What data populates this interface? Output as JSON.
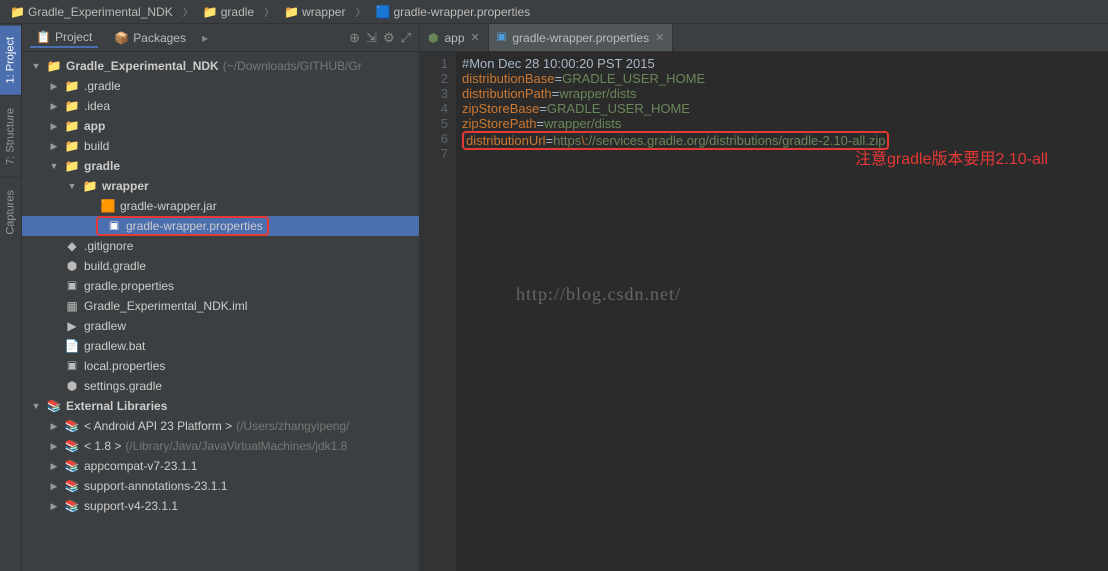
{
  "breadcrumb": [
    {
      "label": "Gradle_Experimental_NDK",
      "icon": "project"
    },
    {
      "label": "gradle",
      "icon": "folder"
    },
    {
      "label": "wrapper",
      "icon": "folder"
    },
    {
      "label": "gradle-wrapper.properties",
      "icon": "properties"
    }
  ],
  "sidebar_tabs": [
    {
      "label": "1: Project",
      "active": true
    },
    {
      "label": "7: Structure",
      "active": false
    },
    {
      "label": "Captures",
      "active": false
    }
  ],
  "panel": {
    "project_tab": "Project",
    "packages_tab": "Packages"
  },
  "tree": {
    "root": {
      "label": "Gradle_Experimental_NDK",
      "hint": "(~/Downloads/GITHUB/Gr"
    },
    "nodes": [
      {
        "label": ".gradle",
        "type": "folder",
        "indent": 1
      },
      {
        "label": ".idea",
        "type": "folder",
        "indent": 1
      },
      {
        "label": "app",
        "type": "folder",
        "bold": true,
        "indent": 1
      },
      {
        "label": "build",
        "type": "folder",
        "indent": 1
      },
      {
        "label": "gradle",
        "type": "folder",
        "bold": true,
        "indent": 1,
        "expanded": true
      },
      {
        "label": "wrapper",
        "type": "folder",
        "bold": true,
        "indent": 2,
        "expanded": true
      },
      {
        "label": "gradle-wrapper.jar",
        "type": "jar",
        "indent": 3
      },
      {
        "label": "gradle-wrapper.properties",
        "type": "properties",
        "indent": 3,
        "selected": true,
        "highlighted": true
      },
      {
        "label": ".gitignore",
        "type": "git",
        "indent": 1
      },
      {
        "label": "build.gradle",
        "type": "gradle",
        "indent": 1
      },
      {
        "label": "gradle.properties",
        "type": "properties",
        "indent": 1
      },
      {
        "label": "Gradle_Experimental_NDK.iml",
        "type": "iml",
        "indent": 1
      },
      {
        "label": "gradlew",
        "type": "sh",
        "indent": 1
      },
      {
        "label": "gradlew.bat",
        "type": "file",
        "indent": 1
      },
      {
        "label": "local.properties",
        "type": "properties",
        "indent": 1
      },
      {
        "label": "settings.gradle",
        "type": "gradle",
        "indent": 1
      }
    ],
    "external": {
      "label": "External Libraries",
      "items": [
        {
          "label": "< Android API 23 Platform >",
          "hint": "(/Users/zhangyipeng/"
        },
        {
          "label": "< 1.8 >",
          "hint": "(/Library/Java/JavaVirtualMachines/jdk1.8"
        },
        {
          "label": "appcompat-v7-23.1.1",
          "hint": ""
        },
        {
          "label": "support-annotations-23.1.1",
          "hint": ""
        },
        {
          "label": "support-v4-23.1.1",
          "hint": ""
        }
      ]
    }
  },
  "editor_tabs": [
    {
      "label": "app",
      "icon": "gradle",
      "active": false
    },
    {
      "label": "gradle-wrapper.properties",
      "icon": "properties",
      "active": true
    }
  ],
  "code": {
    "lines": [
      {
        "n": 1,
        "raw": "#Mon Dec 28 10:00:20 PST 2015"
      },
      {
        "n": 2,
        "key": "distributionBase",
        "val": "GRADLE_USER_HOME"
      },
      {
        "n": 3,
        "key": "distributionPath",
        "val": "wrapper/dists"
      },
      {
        "n": 4,
        "key": "zipStoreBase",
        "val": "GRADLE_USER_HOME"
      },
      {
        "n": 5,
        "key": "zipStorePath",
        "val": "wrapper/dists"
      },
      {
        "n": 6,
        "key": "distributionUrl",
        "val_pre": "https",
        "esc": "\\:",
        "val_post": "//services.gradle.org/distributions/gradle-2.10-all.zip",
        "highlighted": true
      },
      {
        "n": 7,
        "raw": ""
      }
    ]
  },
  "annotation": "注意gradle版本要用2.10-all",
  "watermark": "http://blog.csdn.net/"
}
